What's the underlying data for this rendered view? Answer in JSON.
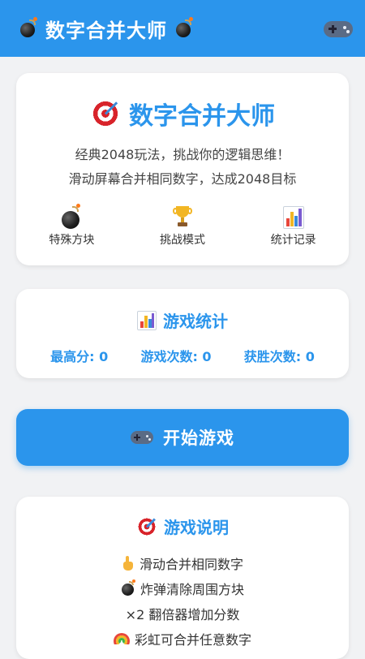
{
  "appbar": {
    "title": "数字合并大师",
    "left_icon": "bomb-icon",
    "right_icon": "gamepad-icon"
  },
  "hero": {
    "title": "数字合并大师",
    "icon": "target-icon",
    "line1": "经典2048玩法，挑战你的逻辑思维！",
    "line2": "滑动屏幕合并相同数字，达成2048目标",
    "features": [
      {
        "icon": "bomb-icon",
        "label": "特殊方块"
      },
      {
        "icon": "trophy-icon",
        "label": "挑战模式"
      },
      {
        "icon": "bar-chart-icon",
        "label": "统计记录"
      }
    ]
  },
  "stats": {
    "title": "游戏统计",
    "icon": "bar-chart-icon",
    "items": [
      {
        "label": "最高分",
        "value": "0",
        "text": "最高分: 0"
      },
      {
        "label": "游戏次数",
        "value": "0",
        "text": "游戏次数: 0"
      },
      {
        "label": "获胜次数",
        "value": "0",
        "text": "获胜次数: 0"
      }
    ]
  },
  "start_button": {
    "label": "开始游戏",
    "icon": "gamepad-icon"
  },
  "help": {
    "title": "游戏说明",
    "icon": "target-icon",
    "items": [
      {
        "icon": "pointing-hand-icon",
        "text": "滑动合并相同数字"
      },
      {
        "icon": "bomb-icon",
        "text": "炸弹清除周围方块"
      },
      {
        "icon": "",
        "text": "×2 翻倍器增加分数"
      },
      {
        "icon": "rainbow-icon",
        "text": "彩虹可合并任意数字"
      }
    ]
  },
  "colors": {
    "primary": "#2b95ec",
    "background": "#f1f2f4",
    "card": "#ffffff",
    "text": "#333333"
  }
}
